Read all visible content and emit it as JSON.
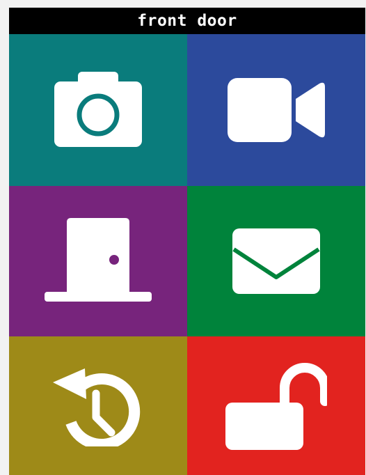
{
  "header": {
    "title": "front door"
  },
  "colors": {
    "title_bar": "#000000",
    "title_text": "#ffffff",
    "icon": "#ffffff"
  },
  "tiles": [
    {
      "id": "snapshot",
      "icon": "camera-icon",
      "color": "#0a7c7c"
    },
    {
      "id": "video",
      "icon": "video-camera-icon",
      "color": "#2c4a9c"
    },
    {
      "id": "door",
      "icon": "door-icon",
      "color": "#77247c"
    },
    {
      "id": "messages",
      "icon": "envelope-icon",
      "color": "#00833b"
    },
    {
      "id": "history",
      "icon": "history-clock-icon",
      "color": "#9e8a18"
    },
    {
      "id": "unlock",
      "icon": "unlocked-padlock-icon",
      "color": "#e2231f"
    }
  ]
}
